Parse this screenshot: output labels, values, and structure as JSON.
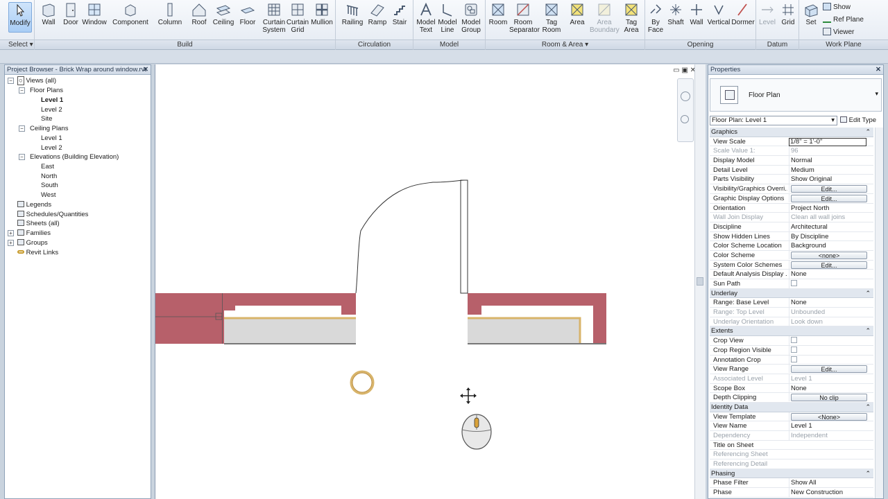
{
  "ribbon": {
    "tools": {
      "modify": "Modify",
      "wall": "Wall",
      "door": "Door",
      "window": "Window",
      "component": "Component",
      "column": "Column",
      "roof": "Roof",
      "ceiling": "Ceiling",
      "floor": "Floor",
      "curtain_system_1": "Curtain",
      "curtain_system_2": "System",
      "curtain_grid_1": "Curtain",
      "curtain_grid_2": "Grid",
      "mullion": "Mullion",
      "railing": "Railing",
      "ramp": "Ramp",
      "stair": "Stair",
      "model_text_1": "Model",
      "model_text_2": "Text",
      "model_line_1": "Model",
      "model_line_2": "Line",
      "model_group_1": "Model",
      "model_group_2": "Group",
      "room": "Room",
      "room_sep_1": "Room",
      "room_sep_2": "Separator",
      "tag_room_1": "Tag",
      "tag_room_2": "Room",
      "area": "Area",
      "area_boundary_1": "Area",
      "area_boundary_2": "Boundary",
      "tag_area_1": "Tag",
      "tag_area_2": "Area",
      "by_face_1": "By",
      "by_face_2": "Face",
      "shaft": "Shaft",
      "op_wall": "Wall",
      "vertical": "Vertical",
      "dormer": "Dormer",
      "level": "Level",
      "grid": "Grid",
      "set": "Set",
      "show": "Show",
      "ref_plane": "Ref Plane",
      "viewer": "Viewer"
    },
    "groups": {
      "select": "Select ▾",
      "build": "Build",
      "circulation": "Circulation",
      "model": "Model",
      "room_area": "Room & Area ▾",
      "opening": "Opening",
      "datum": "Datum",
      "work_plane": "Work Plane"
    }
  },
  "browser": {
    "title": "Project Browser - Brick Wrap around window.rvt",
    "close": "✕",
    "items": {
      "views_all": "Views (all)",
      "floor_plans": "Floor Plans",
      "level1": "Level 1",
      "level2": "Level 2",
      "site": "Site",
      "ceiling_plans": "Ceiling Plans",
      "c_level1": "Level 1",
      "c_level2": "Level 2",
      "elevations": "Elevations (Building Elevation)",
      "east": "East",
      "north": "North",
      "south": "South",
      "west": "West",
      "legends": "Legends",
      "schedules": "Schedules/Quantities",
      "sheets": "Sheets (all)",
      "families": "Families",
      "groups": "Groups",
      "revit_links": "Revit Links"
    }
  },
  "canvas": {
    "window_controls": "▭ ▣ ✕"
  },
  "properties": {
    "title": "Properties",
    "close": "✕",
    "type_name": "Floor Plan",
    "instance": "Floor Plan: Level 1",
    "edit_type": "Edit Type",
    "sections": {
      "graphics": "Graphics",
      "underlay": "Underlay",
      "extents": "Extents",
      "identity": "Identity Data",
      "phasing": "Phasing"
    },
    "collapse": "⌃",
    "rows": {
      "view_scale_k": "View Scale",
      "view_scale_v": "1/8\" = 1'-0\"",
      "scale_value_k": "Scale Value    1:",
      "scale_value_v": "96",
      "display_model_k": "Display Model",
      "display_model_v": "Normal",
      "detail_level_k": "Detail Level",
      "detail_level_v": "Medium",
      "parts_vis_k": "Parts Visibility",
      "parts_vis_v": "Show Original",
      "vg_k": "Visibility/Graphics Overri...",
      "vg_v": "Edit...",
      "gdo_k": "Graphic Display Options",
      "gdo_v": "Edit...",
      "orientation_k": "Orientation",
      "orientation_v": "Project North",
      "wall_join_k": "Wall Join Display",
      "wall_join_v": "Clean all wall joins",
      "discipline_k": "Discipline",
      "discipline_v": "Architectural",
      "hidden_lines_k": "Show Hidden Lines",
      "hidden_lines_v": "By Discipline",
      "csl_k": "Color Scheme Location",
      "csl_v": "Background",
      "cs_k": "Color Scheme",
      "cs_v": "<none>",
      "scs_k": "System Color Schemes",
      "scs_v": "Edit...",
      "dads_k": "Default Analysis Display ...",
      "dads_v": "None",
      "sun_path_k": "Sun Path",
      "base_level_k": "Range: Base Level",
      "base_level_v": "None",
      "top_level_k": "Range: Top Level",
      "top_level_v": "Unbounded",
      "underlay_or_k": "Underlay Orientation",
      "underlay_or_v": "Look down",
      "crop_view_k": "Crop View",
      "crop_region_k": "Crop Region Visible",
      "ann_crop_k": "Annotation Crop",
      "view_range_k": "View Range",
      "view_range_v": "Edit...",
      "assoc_level_k": "Associated Level",
      "assoc_level_v": "Level 1",
      "scope_box_k": "Scope Box",
      "scope_box_v": "None",
      "depth_clip_k": "Depth Clipping",
      "depth_clip_v": "No clip",
      "view_template_k": "View Template",
      "view_template_v": "<None>",
      "view_name_k": "View Name",
      "view_name_v": "Level 1",
      "dependency_k": "Dependency",
      "dependency_v": "Independent",
      "title_sheet_k": "Title on Sheet",
      "ref_sheet_k": "Referencing Sheet",
      "ref_detail_k": "Referencing Detail",
      "phase_filter_k": "Phase Filter",
      "phase_filter_v": "Show All",
      "phase_k": "Phase",
      "phase_v": "New Construction"
    }
  },
  "colors": {
    "brick": "#b7606a",
    "insulation": "#d8b46a",
    "accent": "#3f7fc7"
  }
}
